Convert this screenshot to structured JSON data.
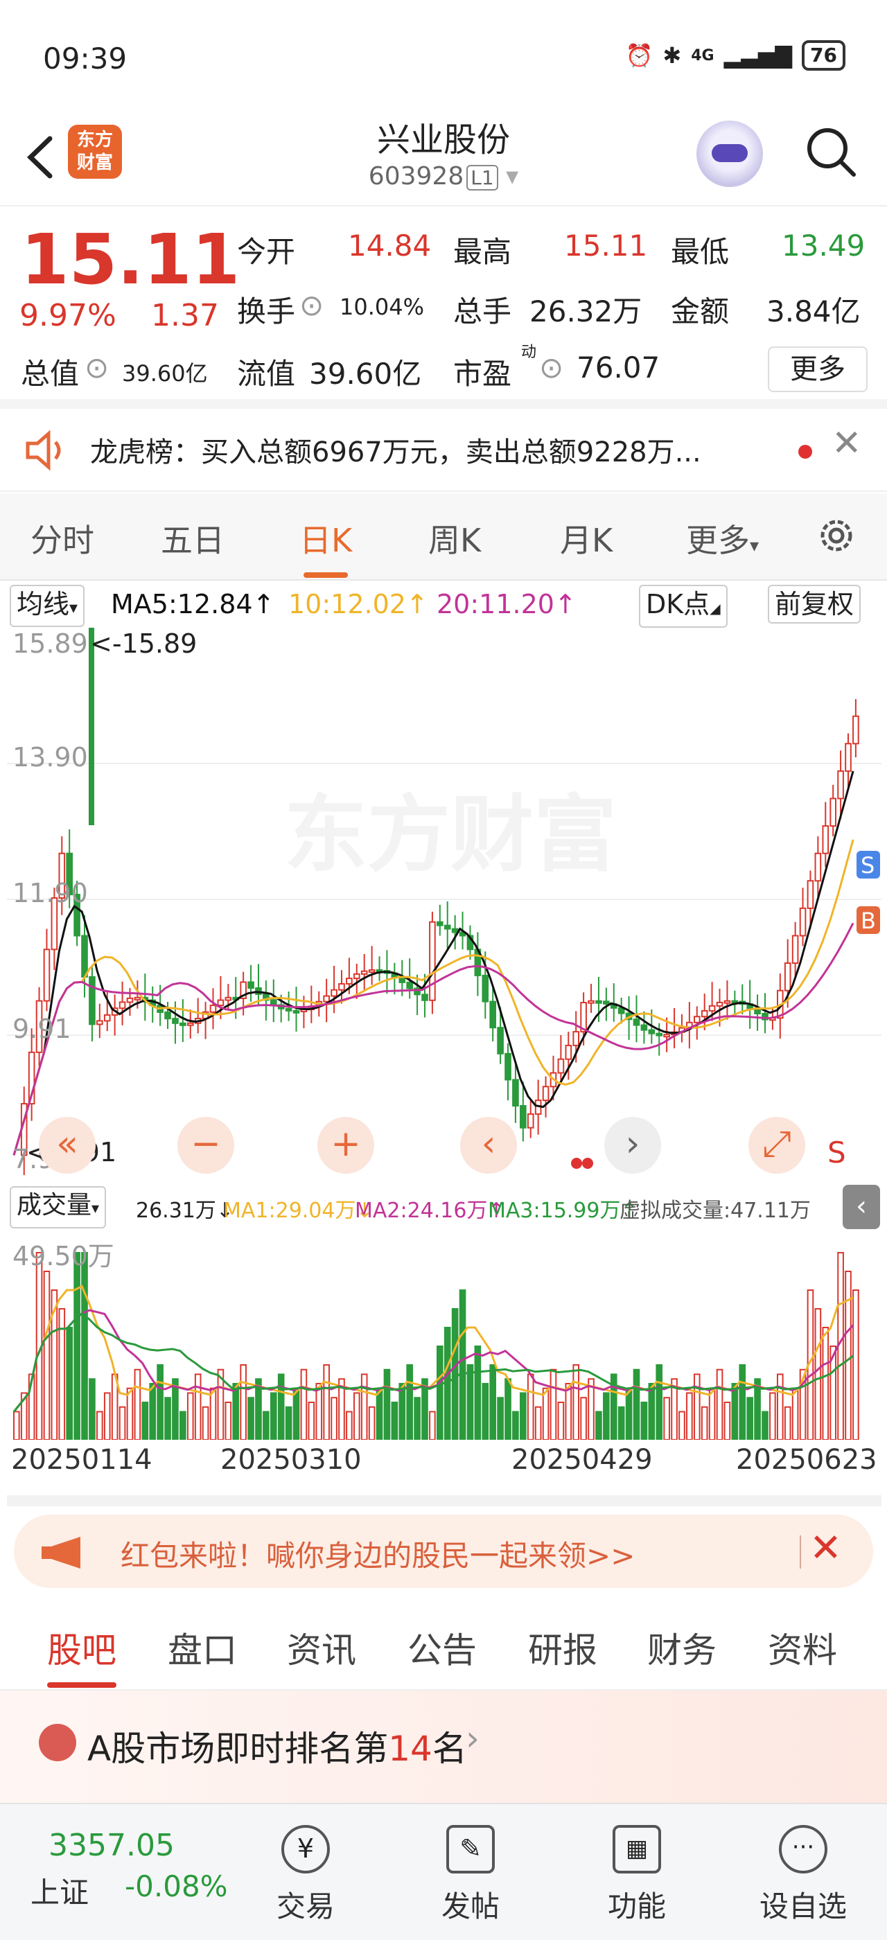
{
  "status": {
    "time": "09:39",
    "net": "4G",
    "battery": "76"
  },
  "header": {
    "title": "兴业股份",
    "code": "603928",
    "code_tag": "L1",
    "logo": "东方财富"
  },
  "quote": {
    "price": "15.11",
    "pct": "9.97%",
    "change": "1.37",
    "open_label": "今开",
    "open": "14.84",
    "high_label": "最高",
    "high": "15.11",
    "low_label": "最低",
    "low": "13.49",
    "turnover_label": "换手",
    "turnover": "10.04%",
    "volume_label": "总手",
    "volume": "26.32万",
    "amount_label": "金额",
    "amount": "3.84亿",
    "mktcap_label": "总值",
    "mktcap": "39.60亿",
    "float_label": "流值",
    "float": "39.60亿",
    "pe_label": "市盈",
    "pe_sup": "动",
    "pe": "76.07",
    "more": "更多"
  },
  "lhb": {
    "text": "龙虎榜：买入总额6967万元，卖出总额9228万..."
  },
  "tabs": [
    {
      "label": "分时"
    },
    {
      "label": "五日"
    },
    {
      "label": "日K",
      "active": true
    },
    {
      "label": "周K"
    },
    {
      "label": "月K"
    },
    {
      "label": "更多"
    }
  ],
  "ma": {
    "selector": "均线",
    "ma5": "MA5:12.84↑",
    "ma10": "10:12.02↑",
    "ma20": "20:11.20↑",
    "dk": "DK点",
    "adjust": "前复权"
  },
  "colors": {
    "up": "#d9362c",
    "down": "#2a9a3c",
    "ma5": "#111111",
    "ma10": "#f0b429",
    "ma20": "#c23397"
  },
  "chart_labels": {
    "y_high": "15.89",
    "y_high_marker": "<-15.89",
    "y_low": "7.91",
    "y_low_marker": "<-7.91",
    "watermark": "东方财富",
    "s_badge": "S",
    "b_badge": "B",
    "s_mark": "S"
  },
  "chart_data": {
    "type": "candlestick",
    "y_ticks": [
      "15.89",
      "13.90",
      "11.90",
      "9.91",
      "7.91"
    ],
    "ylim": [
      7.91,
      15.89
    ],
    "max_marker": 15.89,
    "min_marker": 7.91,
    "x_ticks": [
      "20250114",
      "20250310",
      "20250429",
      "20250623"
    ]
  },
  "volume": {
    "selector": "成交量",
    "value": "26.31万↓",
    "ma1": "MA1:29.04万↓",
    "ma2": "MA2:24.16万↑",
    "ma3": "MA3:15.99万↑",
    "virtual": "虚拟成交量:47.11万",
    "y_max": "49.50万"
  },
  "dates": [
    "20250114",
    "20250310",
    "20250429",
    "20250623"
  ],
  "promo": {
    "text": "红包来啦！喊你身边的股民一起来领>>"
  },
  "content_tabs": [
    {
      "label": "股吧",
      "active": true
    },
    {
      "label": "盘口"
    },
    {
      "label": "资讯"
    },
    {
      "label": "公告"
    },
    {
      "label": "研报"
    },
    {
      "label": "财务"
    },
    {
      "label": "资料"
    }
  ],
  "rank": {
    "prefix": "A股市场即时排名第",
    "num": "14",
    "suffix": "名"
  },
  "bottom": {
    "index_value": "3357.05",
    "index_name": "上证",
    "index_pct": "-0.08%",
    "nav": [
      {
        "label": "交易"
      },
      {
        "label": "发帖"
      },
      {
        "label": "功能"
      },
      {
        "label": "设自选"
      }
    ]
  }
}
